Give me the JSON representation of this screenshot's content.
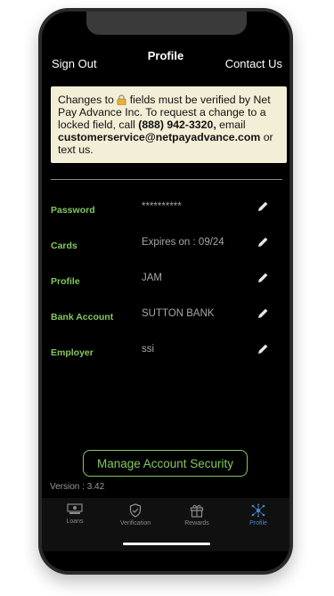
{
  "header": {
    "title": "Profile",
    "sign_out": "Sign Out",
    "contact_us": "Contact Us"
  },
  "notice": {
    "part1": "Changes to ",
    "part2": " fields must be verified by Net Pay Advance Inc. To request a change to a locked field, call ",
    "phone": "(888) 942-3320,",
    "part3": " email ",
    "email": "customerservice@netpayadvance.com",
    "part4": " or text us."
  },
  "rows": [
    {
      "label": "Password",
      "value": "**********"
    },
    {
      "label": "Cards",
      "value": "Expires on : 09/24"
    },
    {
      "label": "Profile",
      "value": "JAM"
    },
    {
      "label": "Bank Account",
      "value": "SUTTON BANK"
    },
    {
      "label": "Employer",
      "value": "ssi"
    }
  ],
  "manage_button": "Manage Account Security",
  "version": "Version : 3.42",
  "tabs": [
    {
      "label": "Loans",
      "icon": "money-icon",
      "active": false
    },
    {
      "label": "Verification",
      "icon": "shield-check-icon",
      "active": false
    },
    {
      "label": "Rewards",
      "icon": "gift-icon",
      "active": false
    },
    {
      "label": "Profile",
      "icon": "network-icon",
      "active": true
    }
  ],
  "colors": {
    "accent_green": "#84c85f",
    "active_tab": "#4a87c9",
    "notice_bg": "#f3eed6"
  }
}
